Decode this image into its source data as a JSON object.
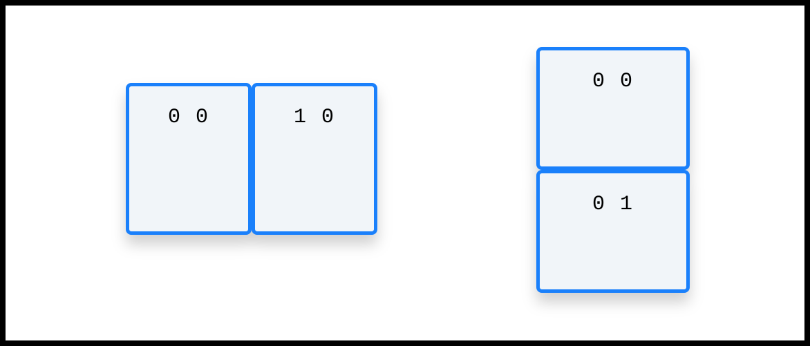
{
  "groups": {
    "horizontal": {
      "cells": [
        {
          "label": "0 0"
        },
        {
          "label": "1 0"
        }
      ]
    },
    "vertical": {
      "cells": [
        {
          "label": "0 0"
        },
        {
          "label": "0 1"
        }
      ]
    }
  }
}
